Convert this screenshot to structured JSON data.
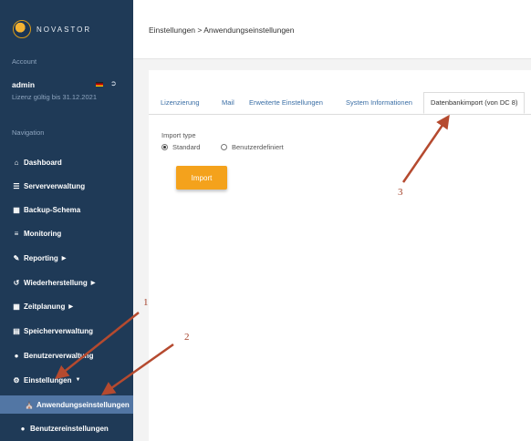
{
  "logo": {
    "text": "NOVASTOR",
    "icon": "novastor-logo"
  },
  "sidebar": {
    "account_label": "Account",
    "user_name": "admin",
    "license": "Lizenz gültig bis 31.12.2021",
    "navigation_label": "Navigation",
    "items": [
      {
        "label": "Dashboard",
        "icon": "home-icon"
      },
      {
        "label": "Serververwaltung",
        "icon": "server-icon"
      },
      {
        "label": "Backup-Schema",
        "icon": "calendar-icon"
      },
      {
        "label": "Monitoring",
        "icon": "list-icon"
      },
      {
        "label": "Reporting",
        "icon": "edit-icon"
      },
      {
        "label": "Wiederherstellung",
        "icon": "restore-icon"
      },
      {
        "label": "Zeitplanung",
        "icon": "calendar-icon"
      },
      {
        "label": "Speicherverwaltung",
        "icon": "storage-icon"
      },
      {
        "label": "Benutzerverwaltung",
        "icon": "user-icon"
      },
      {
        "label": "Einstellungen",
        "icon": "gear-icon"
      },
      {
        "label": "Anwendungseinstellungen",
        "icon": "building-icon"
      },
      {
        "label": "Benutzereinstellungen",
        "icon": "users-icon"
      }
    ]
  },
  "breadcrumb": "Einstellungen > Anwendungseinstellungen",
  "tabs": [
    "Lizenzierung",
    "Mail",
    "Erweiterte Einstellungen",
    "System Informationen",
    "Datenbankimport (von DC 8)"
  ],
  "form": {
    "import_type_label": "Import type",
    "option_standard": "Standard",
    "option_custom": "Benutzerdefiniert",
    "selected": "Standard",
    "import_button": "Import"
  },
  "annotations": [
    "1",
    "2",
    "3"
  ],
  "colors": {
    "sidebar": "#1f3a57",
    "active": "#5276a4",
    "button": "#f4a21c",
    "annotation": "#b54a2f"
  }
}
